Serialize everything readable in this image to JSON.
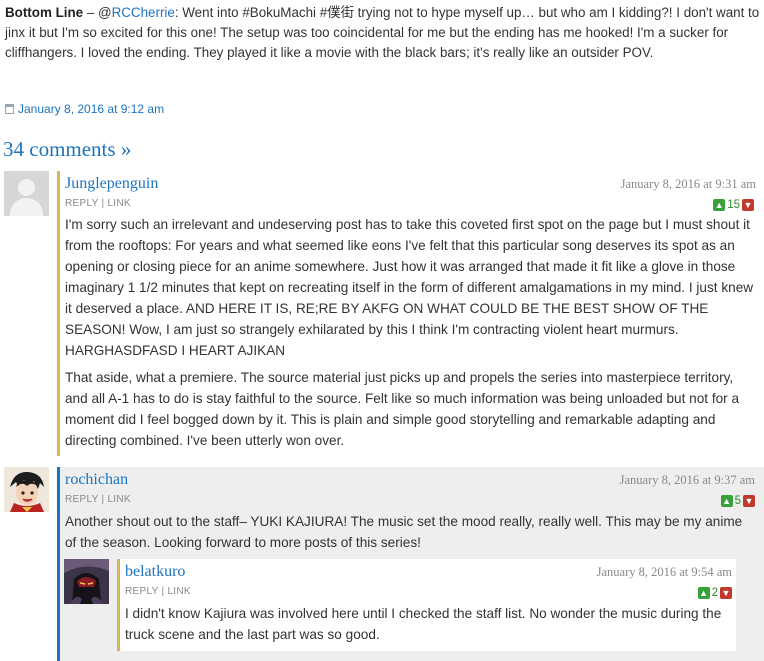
{
  "post": {
    "bottom_line_label": "Bottom Line",
    "dash": " – @",
    "mention": "RCCherrie",
    "text": ": Went into #BokuMachi #僕街 trying not to hype myself up… but who am I kidding?! I don't want to jinx it but I'm so excited for this one! The setup was too coincidental for me but the ending has me hooked! I'm a sucker for cliffhangers. I loved the ending. They played it like a movie with the black bars; it's really like an outsider POV.",
    "date": "January 8, 2016 at 9:12 am"
  },
  "comments_link": "34 comments »",
  "comments": [
    {
      "author": "Junglepenguin",
      "date": "January 8, 2016 at 9:31 am",
      "reply": "REPLY",
      "sep": " | ",
      "link": "LINK",
      "votes": "15",
      "paragraphs": [
        "I'm sorry such an irrelevant and undeserving post has to take this coveted first spot on the page but I must shout it from the rooftops: For years and what seemed like eons I've felt that this particular song deserves its spot as an opening or closing piece for an anime somewhere. Just how it was arranged that made it fit like a glove in those imaginary 1 1/2 minutes that kept on recreating itself in the form of different amalgamations in my mind. I just knew it deserved a place. AND HERE IT IS, RE;RE BY AKFG ON WHAT COULD BE THE BEST SHOW OF THE SEASON! Wow, I am just so strangely exhilarated by this I think I'm contracting violent heart murmurs. HARGHASDFASD I HEART AJIKAN",
        "That aside, what a premiere. The source material just picks up and propels the series into masterpiece territory, and all A-1 has to do is stay faithful to the source. Felt like so much information was being unloaded but not for a moment did I feel bogged down by it. This is plain and simple good storytelling and remarkable adapting and directing combined. I've been utterly won over."
      ]
    },
    {
      "author": "rochichan",
      "date": "January 8, 2016 at 9:37 am",
      "reply": "REPLY",
      "sep": " | ",
      "link": "LINK",
      "votes": "5",
      "paragraphs": [
        "Another shout out to the staff– YUKI KAJIURA! The music set the mood really, really well. This may be my anime of the season. Looking forward to more posts of this series!"
      ]
    },
    {
      "author": "belatkuro",
      "date": "January 8, 2016 at 9:54 am",
      "reply": "REPLY",
      "sep": " | ",
      "link": "LINK",
      "votes": "2",
      "paragraphs": [
        "I didn't know Kajiura was involved here until I checked the staff list. No wonder the music during the truck scene and the last part was so good."
      ]
    }
  ],
  "icons": {
    "vote_up": "thumbs-up-icon",
    "vote_down": "thumbs-down-icon",
    "date": "calendar-icon"
  },
  "colors": {
    "link": "#1e73be",
    "gold_border": "#d8b45a",
    "blue_border": "#1e73be",
    "vote_up": "#3aa13a",
    "vote_down": "#c0392b"
  }
}
